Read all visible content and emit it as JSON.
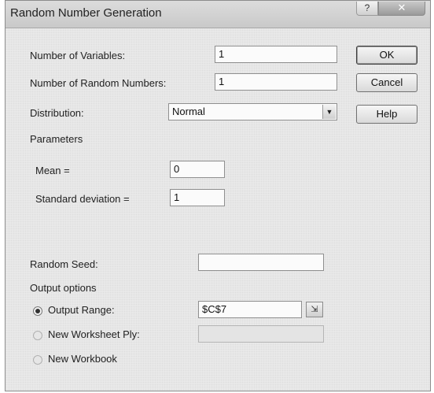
{
  "window": {
    "title": "Random Number Generation",
    "help_glyph": "?",
    "close_glyph": "✕"
  },
  "labels": {
    "num_variables": "Number of Variables:",
    "num_random_numbers": "Number of Random Numbers:",
    "distribution": "Distribution:",
    "parameters": "Parameters",
    "mean": "Mean =",
    "std_dev": "Standard deviation =",
    "random_seed": "Random Seed:",
    "output_options": "Output options",
    "output_range": "Output Range:",
    "new_worksheet_ply": "New Worksheet Ply:",
    "new_workbook": "New Workbook"
  },
  "values": {
    "num_variables": "1",
    "num_random_numbers": "1",
    "distribution": "Normal",
    "mean": "0",
    "std_dev": "1",
    "random_seed": "",
    "output_range": "$C$7",
    "new_worksheet_ply": ""
  },
  "buttons": {
    "ok": "OK",
    "cancel": "Cancel",
    "help": "Help"
  },
  "output_selection": "output_range",
  "icons": {
    "select_arrow": "▼",
    "collapse_dialog": "⇲"
  }
}
